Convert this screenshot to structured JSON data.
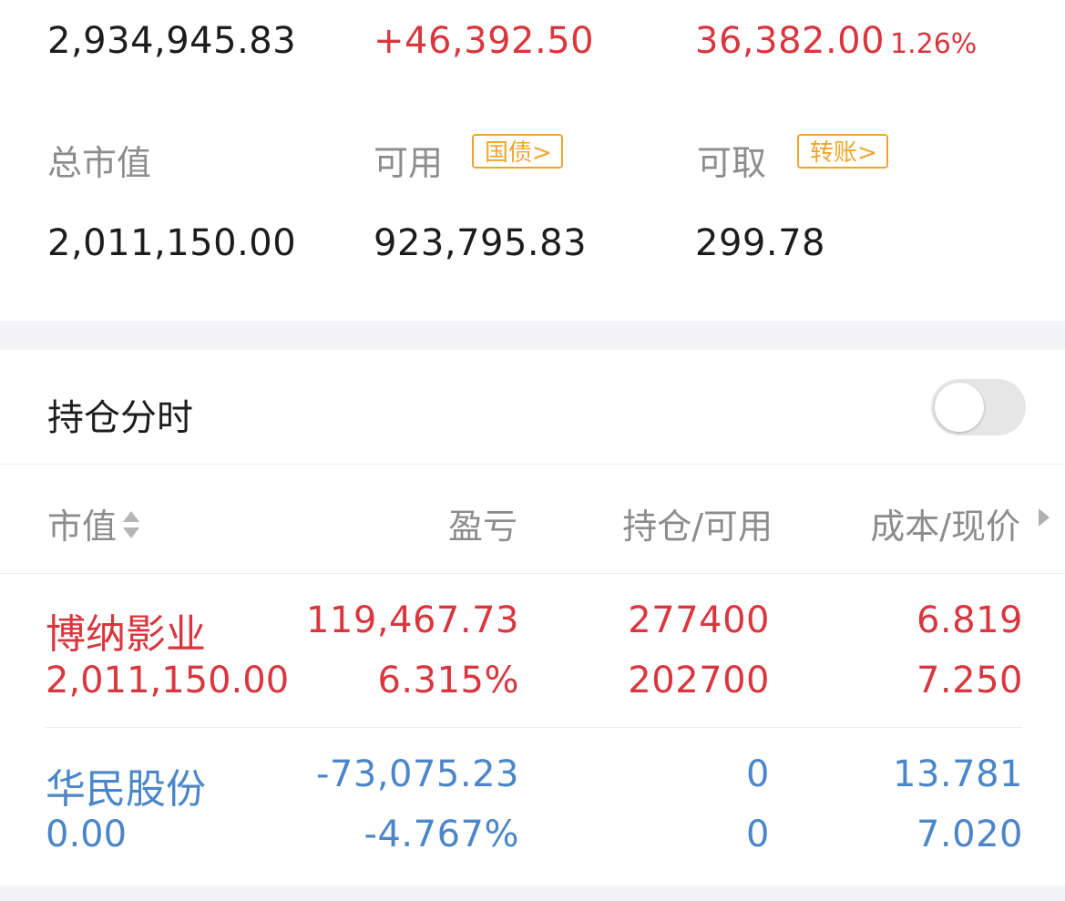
{
  "summary": {
    "total_assets": "2,934,945.83",
    "float_pnl": "+46,392.50",
    "today_pnl": "36,382.00",
    "today_pnl_pct": "1.26%"
  },
  "account": {
    "market_value_label": "总市值",
    "available_label": "可用",
    "treasury_badge": "国债>",
    "withdrawable_label": "可取",
    "transfer_badge": "转账>",
    "market_value": "2,011,150.00",
    "available": "923,795.83",
    "withdrawable": "299.78"
  },
  "positions_timeline": {
    "label": "持仓分时",
    "toggle_on": false
  },
  "table": {
    "headers": {
      "market_value": "市值",
      "pnl": "盈亏",
      "holding_available": "持仓/可用",
      "cost_price": "成本/现价"
    },
    "rows": [
      {
        "name": "博纳影业",
        "market_value": "2,011,150.00",
        "pnl": "119,467.73",
        "pnl_pct": "6.315%",
        "holding": "277400",
        "available": "202700",
        "cost": "6.819",
        "price": "7.250",
        "color": "#d9363e"
      },
      {
        "name": "华民股份",
        "market_value": "0.00",
        "pnl": "-73,075.23",
        "pnl_pct": "-4.767%",
        "holding": "0",
        "available": "0",
        "cost": "13.781",
        "price": "7.020",
        "color": "#4a86c8"
      }
    ]
  },
  "colors": {
    "up": "#d9363e",
    "down": "#4a86c8",
    "badge": "#f0a52a"
  },
  "icons": {
    "sort": "sort-arrows-icon",
    "more": "triangle-right-icon"
  }
}
